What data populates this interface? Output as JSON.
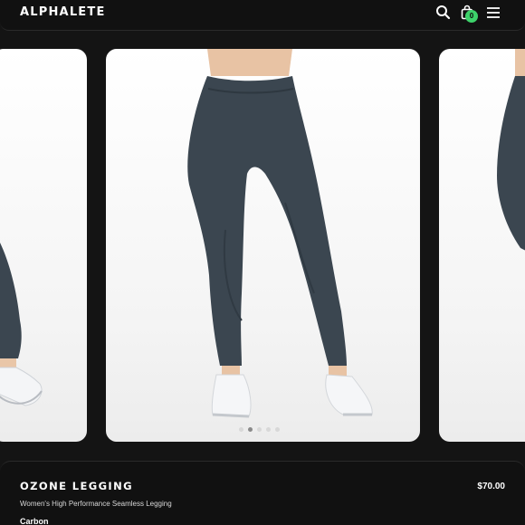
{
  "header": {
    "logo": "ALPHALETE",
    "icons": [
      "search-icon",
      "shopping-bag-icon",
      "hamburger-menu-icon"
    ],
    "cart_count": "0"
  },
  "carousel": {
    "images": [
      "legging-side-view",
      "legging-front-view",
      "legging-back-view"
    ],
    "dot_count": 5,
    "active_index": 1
  },
  "product": {
    "name": "OZONE LEGGING",
    "price": "$70.00",
    "subtitle": "Women's High Performance Seamless Legging",
    "color": "Carbon"
  },
  "colors": {
    "background": "#141414",
    "legging": "#3b4650",
    "badge": "#3dd26a"
  }
}
